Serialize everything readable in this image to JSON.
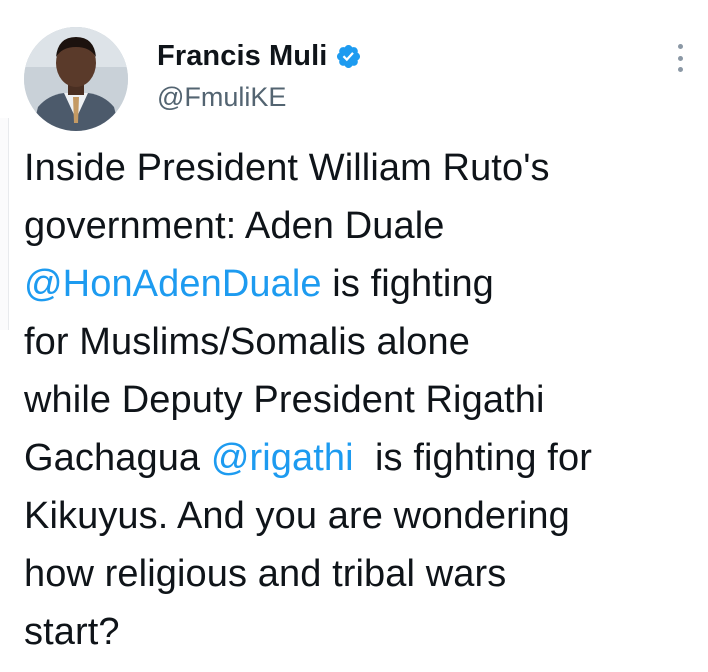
{
  "author": {
    "display_name": "Francis Muli",
    "handle": "@FmuliKE",
    "verified": true
  },
  "tweet_text": {
    "line1": "Inside President William Ruto's",
    "line2": "government: Aden Duale",
    "line3_mention": "@HonAdenDuale",
    "line3_rest": " is fighting",
    "line4": "for Muslims/Somalis alone",
    "line5": "while Deputy President Rigathi",
    "line6_start": "Gachagua ",
    "line6_mention": "@rigathi",
    "line6_rest": "  is fighting for",
    "line7": "Kikuyus. And you are wondering",
    "line8": "how religious and tribal wars",
    "line9": "start?"
  },
  "icons": {
    "verified": "verified-badge-icon",
    "more": "more-vertical-icon"
  },
  "colors": {
    "text": "#0f1419",
    "secondary": "#536471",
    "link": "#1d9bf0",
    "verified": "#1d9bf0"
  }
}
